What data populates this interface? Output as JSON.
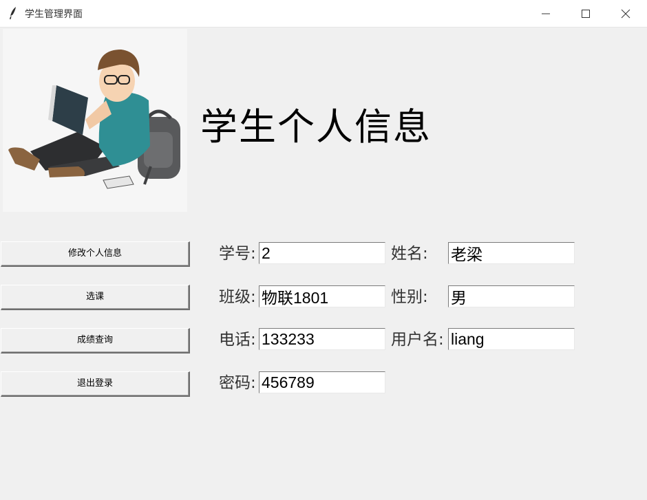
{
  "window": {
    "title": "学生管理界面",
    "controls": {
      "minimize": "minimize-icon",
      "maximize": "maximize-icon",
      "close": "close-icon"
    }
  },
  "header": {
    "title": "学生个人信息"
  },
  "sidebar": {
    "buttons": [
      {
        "label": "修改个人信息"
      },
      {
        "label": "选课"
      },
      {
        "label": "成绩查询"
      },
      {
        "label": "退出登录"
      }
    ]
  },
  "form": {
    "student_id": {
      "label": "学号:",
      "value": "2"
    },
    "name": {
      "label": "姓名:",
      "value": "老梁"
    },
    "class": {
      "label": "班级:",
      "value": "物联1801"
    },
    "gender": {
      "label": "性别:",
      "value": "男"
    },
    "phone": {
      "label": "电话:",
      "value": "133233"
    },
    "username": {
      "label": "用户名:",
      "value": "liang"
    },
    "password": {
      "label": "密码:",
      "value": "456789"
    }
  },
  "colors": {
    "background": "#f0f0f0",
    "titlebar": "#ffffff",
    "shirt": "#2f8f94"
  }
}
